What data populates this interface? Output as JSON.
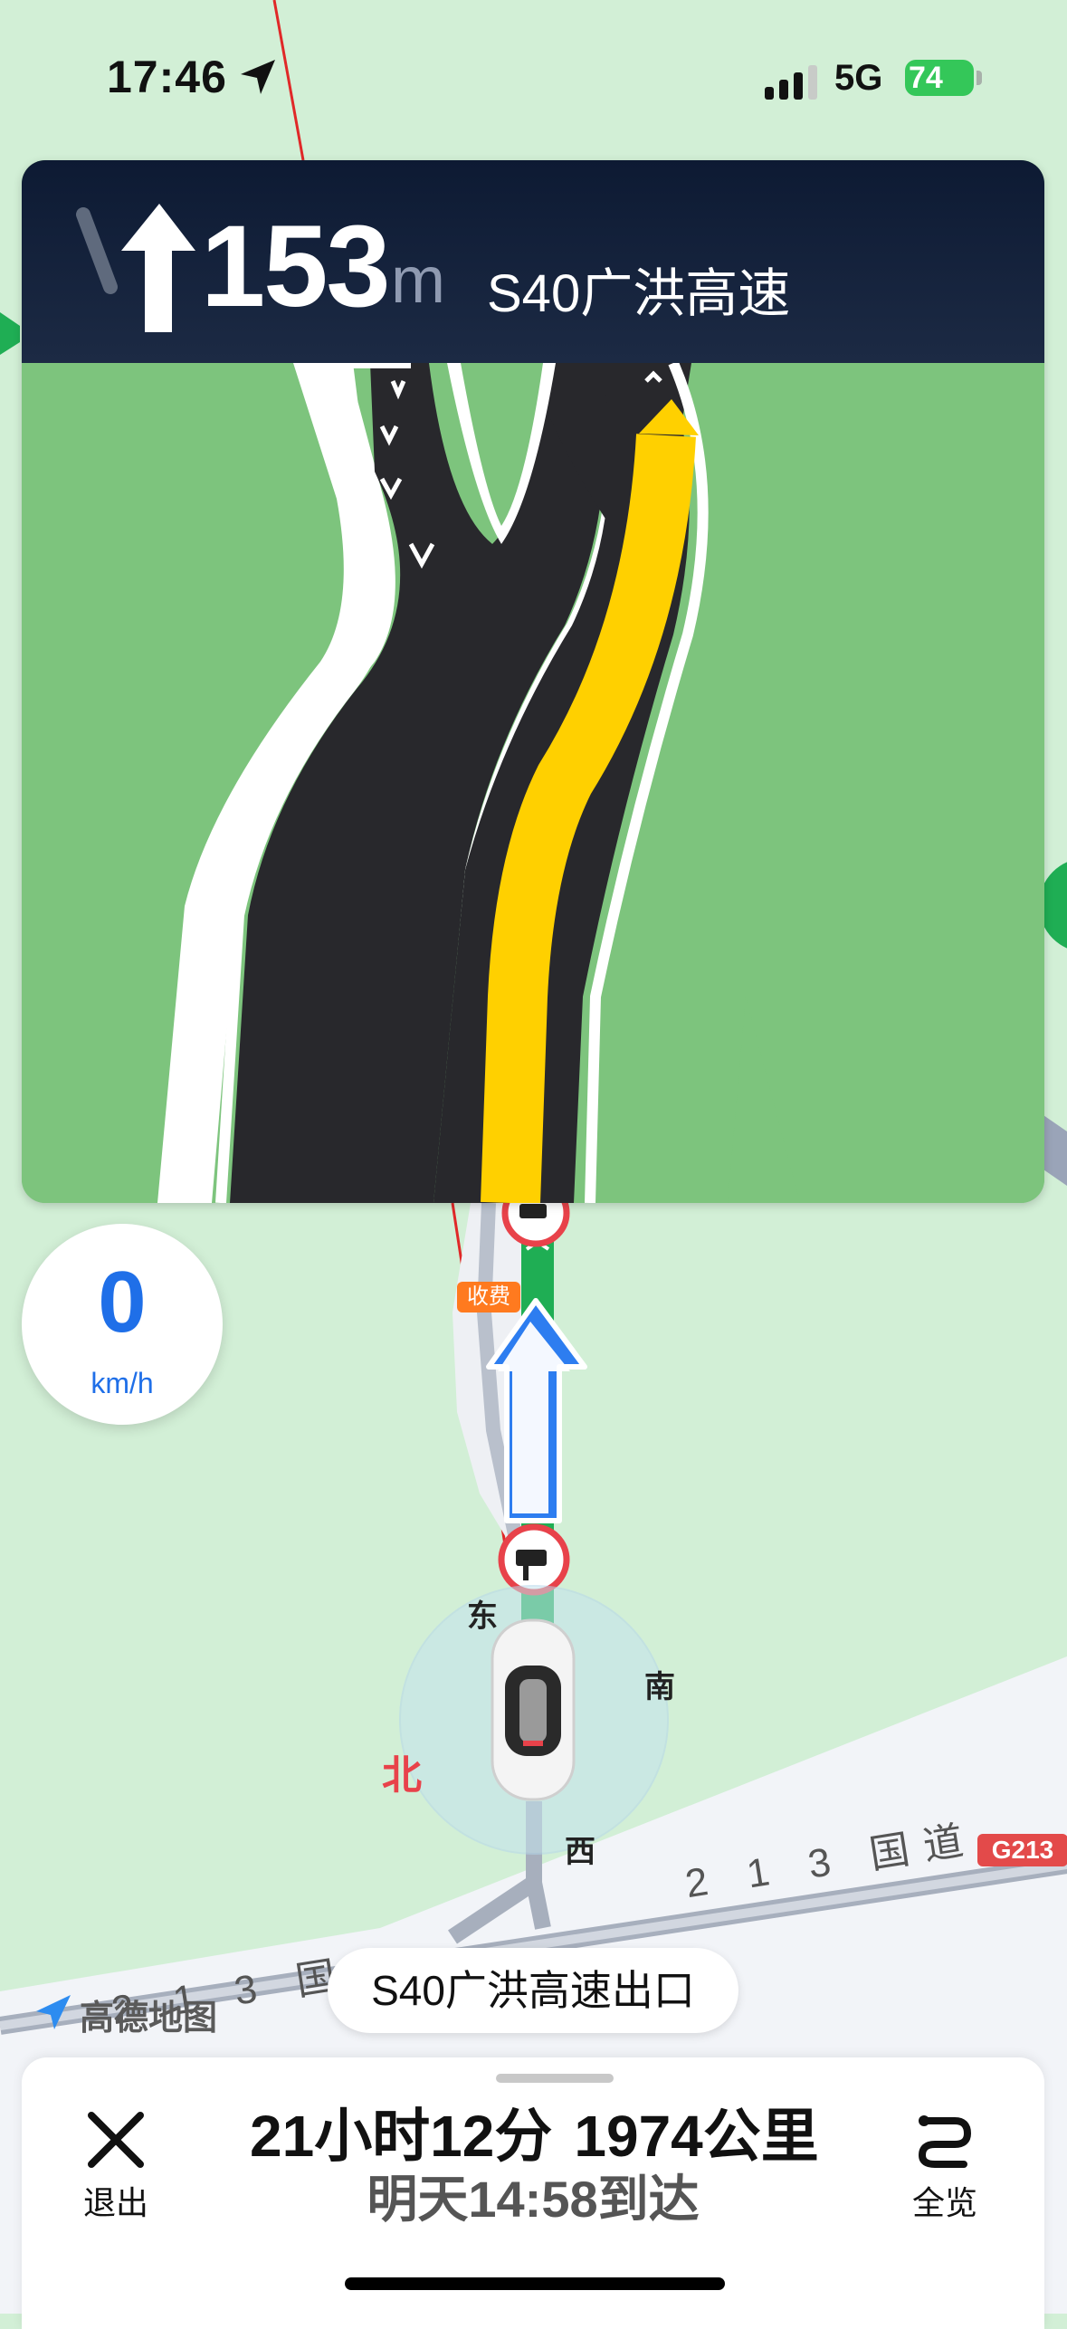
{
  "status_bar": {
    "time": "17:46",
    "network": "5G",
    "battery": "74",
    "icons": [
      "location-arrow-icon",
      "signal-icon",
      "battery-charging-icon"
    ]
  },
  "guidance": {
    "turn_icon": "straight-arrow-icon",
    "distance": "153",
    "distance_unit": "m",
    "road_name": "S40广洪高速"
  },
  "speed": {
    "value": "0",
    "unit": "km/h"
  },
  "map": {
    "toll_label": "收费",
    "compass": {
      "north": "北",
      "east": "东",
      "south": "南",
      "west": "西"
    },
    "road_label_lower": "2 1 3 国道",
    "road_label_upper": "2 1 3 国道",
    "highway_shield": "G213",
    "brand": "高德地图",
    "exit_label": "S40广洪高速出口"
  },
  "bottom_bar": {
    "exit_label": "退出",
    "duration": "21小时12分",
    "distance": "1974公里",
    "eta": "明天14:58到达",
    "overview_label": "全览"
  },
  "colors": {
    "map_bg": "#d2efd6",
    "guide_header": "#0d1a33",
    "route_green": "#1fae54",
    "lane_yellow": "#ffd000",
    "speed_blue": "#1f6fe8",
    "battery_green": "#34c759"
  }
}
